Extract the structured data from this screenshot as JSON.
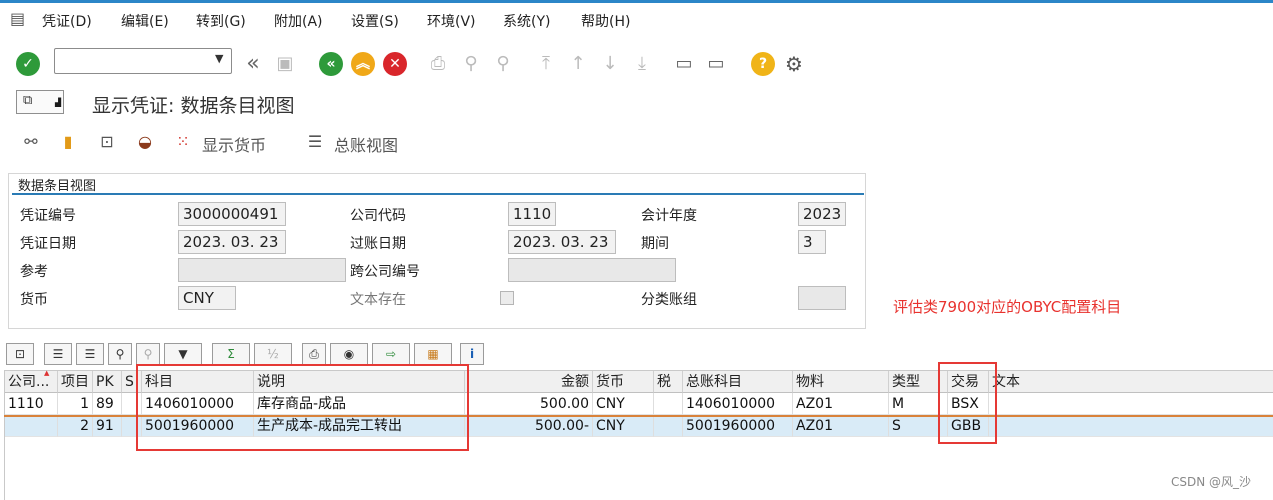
{
  "menu": [
    "凭证(D)",
    "编辑(E)",
    "转到(G)",
    "附加(A)",
    "设置(S)",
    "环境(V)",
    "系统(Y)",
    "帮助(H)"
  ],
  "command_field": {
    "value": ""
  },
  "title": "显示凭证: 数据条目视图",
  "app_toolbar": {
    "display_currency": "显示货币",
    "gl_view": "总账视图"
  },
  "header": {
    "frame_title": "数据条目视图",
    "fields": {
      "doc_no_label": "凭证编号",
      "doc_no": "3000000491",
      "company_code_label": "公司代码",
      "company_code": "1110",
      "fiscal_year_label": "会计年度",
      "fiscal_year": "2023",
      "doc_date_label": "凭证日期",
      "doc_date": "2023. 03. 23",
      "posting_date_label": "过账日期",
      "posting_date": "2023. 03. 23",
      "period_label": "期间",
      "period": "3",
      "reference_label": "参考",
      "reference": "",
      "cross_cc_label": "跨公司编号",
      "cross_cc": "",
      "currency_label": "货币",
      "currency": "CNY",
      "text_exists_label": "文本存在",
      "ledger_group_label": "分类账组",
      "ledger_group": ""
    }
  },
  "annotation": "评估类7900对应的OBYC配置科目",
  "grid": {
    "columns": [
      "公司...",
      "项目",
      "PK",
      "S",
      "科目",
      "说明",
      "金额",
      "货币",
      "税",
      "总账科目",
      "物料",
      "类型",
      "交易",
      "文本"
    ],
    "rows": [
      {
        "company": "1110",
        "item": "1",
        "pk": "89",
        "s": "",
        "account": "1406010000",
        "desc": "库存商品-成品",
        "amount": "500.00",
        "currency": "CNY",
        "tax": "",
        "gl": "1406010000",
        "material": "AZ01",
        "type": "M",
        "trans": "BSX",
        "text": ""
      },
      {
        "company": "",
        "item": "2",
        "pk": "91",
        "s": "",
        "account": "5001960000",
        "desc": "生产成本-成品完工转出",
        "amount": "500.00-",
        "currency": "CNY",
        "tax": "",
        "gl": "5001960000",
        "material": "AZ01",
        "type": "S",
        "trans": "GBB",
        "text": ""
      }
    ]
  },
  "watermark": "CSDN @风_沙",
  "colors": {
    "accent": "#2b86c8",
    "annotation": "#e8322e",
    "selected_row": "#d9ebf7"
  }
}
